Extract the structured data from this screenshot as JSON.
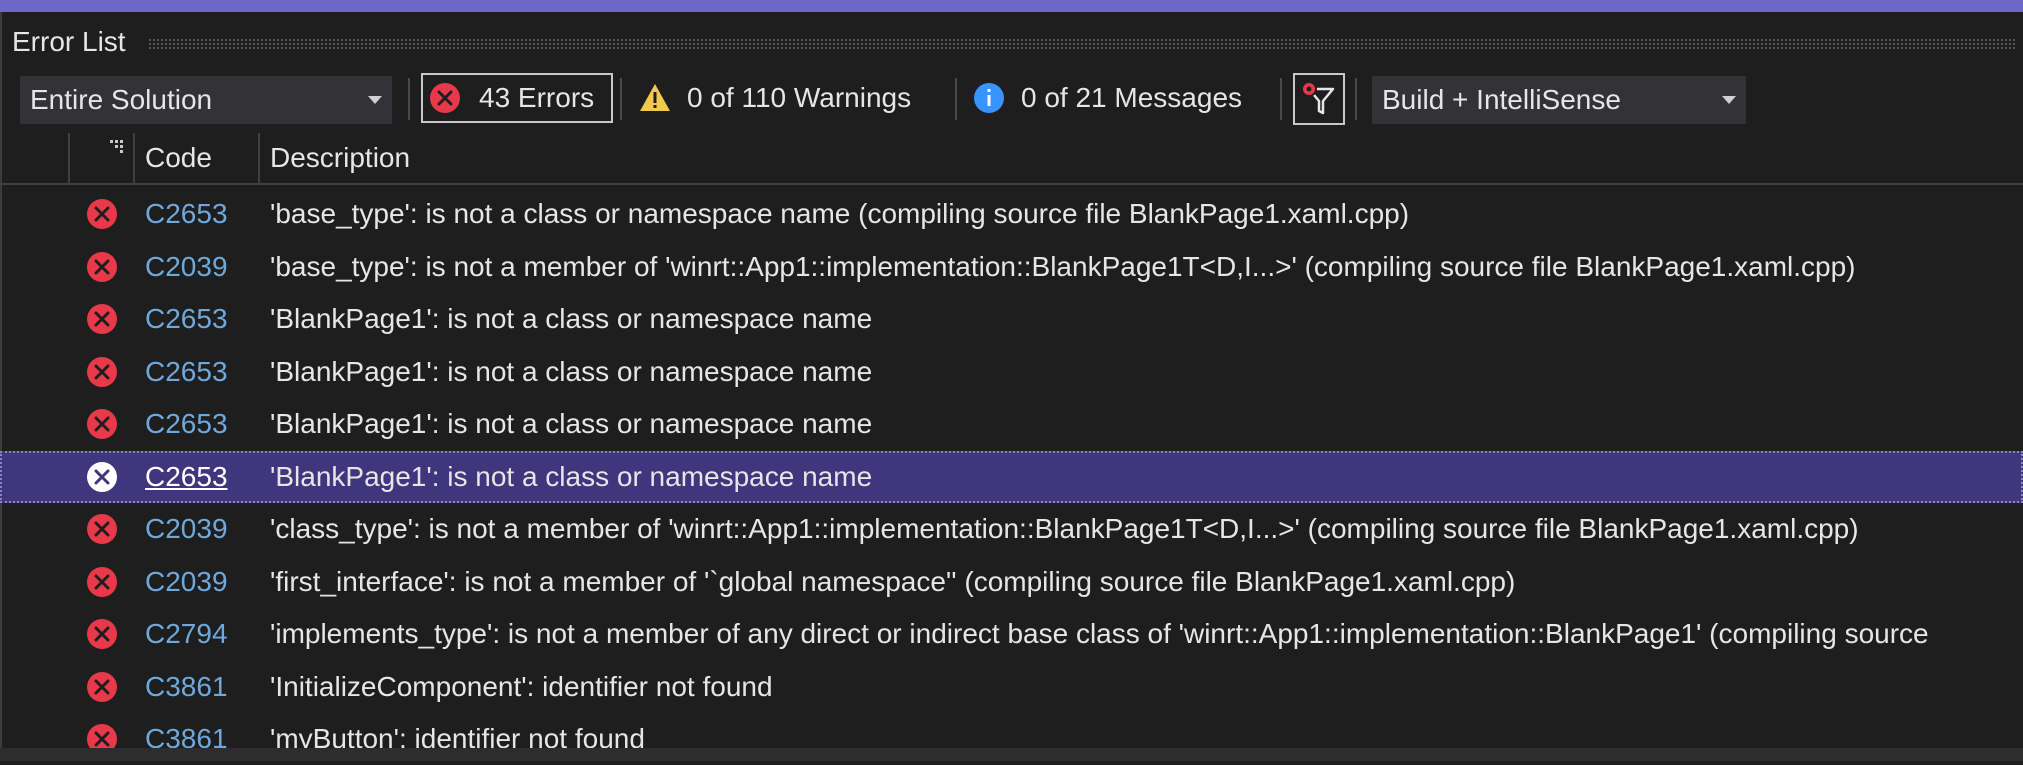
{
  "window": {
    "title": "Error List"
  },
  "toolbar": {
    "scope": {
      "selected": "Entire Solution"
    },
    "errors_label": "43 Errors",
    "warnings_label": "0 of 110 Warnings",
    "messages_label": "0 of 21 Messages",
    "source": {
      "selected": "Build + IntelliSense"
    }
  },
  "columns": {
    "code": "Code",
    "description": "Description"
  },
  "rows": [
    {
      "code": "C2653",
      "description": "'base_type': is not a class or namespace name (compiling source file BlankPage1.xaml.cpp)"
    },
    {
      "code": "C2039",
      "description": "'base_type': is not a member of 'winrt::App1::implementation::BlankPage1T<D,I...>' (compiling source file BlankPage1.xaml.cpp)"
    },
    {
      "code": "C2653",
      "description": "'BlankPage1': is not a class or namespace name"
    },
    {
      "code": "C2653",
      "description": "'BlankPage1': is not a class or namespace name"
    },
    {
      "code": "C2653",
      "description": "'BlankPage1': is not a class or namespace name"
    },
    {
      "code": "C2653",
      "description": "'BlankPage1': is not a class or namespace name",
      "selected": true
    },
    {
      "code": "C2039",
      "description": "'class_type': is not a member of 'winrt::App1::implementation::BlankPage1T<D,I...>' (compiling source file BlankPage1.xaml.cpp)"
    },
    {
      "code": "C2039",
      "description": "'first_interface': is not a member of '`global namespace'' (compiling source file BlankPage1.xaml.cpp)"
    },
    {
      "code": "C2794",
      "description": "'implements_type': is not a member of any direct or indirect base class of 'winrt::App1::implementation::BlankPage1' (compiling source"
    },
    {
      "code": "C3861",
      "description": "'InitializeComponent': identifier not found"
    },
    {
      "code": "C3861",
      "description": "'myButton': identifier not found"
    }
  ],
  "colors": {
    "accent": "#6d67c8",
    "error_icon": "#e8394a",
    "warning_icon": "#f2c94c",
    "info_icon": "#3794ff",
    "code_link": "#6fa8dc",
    "selected_row": "#40367e"
  }
}
